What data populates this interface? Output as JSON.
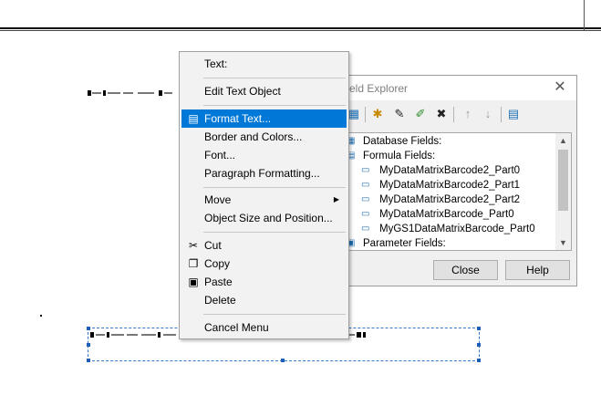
{
  "field_explorer": {
    "title": "eld Explorer",
    "close_glyph": "✕",
    "toolbar": [
      {
        "icon": "insert-to-report-icon",
        "glyph": "▦"
      },
      {
        "icon": "new-icon",
        "glyph": "✱"
      },
      {
        "icon": "edit-icon",
        "glyph": "✎"
      },
      {
        "icon": "rename-icon",
        "glyph": "✐"
      },
      {
        "icon": "delete-icon",
        "glyph": "✖"
      },
      {
        "icon": "move-up-icon",
        "glyph": "↑"
      },
      {
        "icon": "move-down-icon",
        "glyph": "↓"
      },
      {
        "icon": "browse-icon",
        "glyph": "▤"
      }
    ],
    "tree": [
      {
        "label": "Database Fields:",
        "level": 0,
        "icon": "database-fields-icon"
      },
      {
        "label": "Formula Fields:",
        "level": 0,
        "icon": "formula-fields-icon"
      },
      {
        "label": "MyDataMatrixBarcode2_Part0",
        "level": 1,
        "icon": "formula-icon"
      },
      {
        "label": "MyDataMatrixBarcode2_Part1",
        "level": 1,
        "icon": "formula-icon"
      },
      {
        "label": "MyDataMatrixBarcode2_Part2",
        "level": 1,
        "icon": "formula-icon"
      },
      {
        "label": "MyDataMatrixBarcode_Part0",
        "level": 1,
        "icon": "formula-icon"
      },
      {
        "label": "MyGS1DataMatrixBarcode_Part0",
        "level": 1,
        "icon": "formula-icon"
      },
      {
        "label": "Parameter Fields:",
        "level": 0,
        "icon": "parameter-fields-icon"
      }
    ],
    "buttons": {
      "close": "Close",
      "help": "Help"
    }
  },
  "context_menu": {
    "items": [
      {
        "label": "Text:",
        "icon": "",
        "highlighted": false
      },
      {
        "label": "Edit Text Object",
        "icon": "",
        "highlighted": false
      },
      {
        "label": "Format Text...",
        "icon": "format-text-icon",
        "highlighted": true
      },
      {
        "label": "Border and Colors...",
        "icon": "",
        "highlighted": false
      },
      {
        "label": "Font...",
        "icon": "",
        "highlighted": false
      },
      {
        "label": "Paragraph Formatting...",
        "icon": "",
        "highlighted": false
      },
      {
        "label": "Move",
        "icon": "",
        "highlighted": false,
        "submenu": true
      },
      {
        "label": "Object Size and Position...",
        "icon": "",
        "highlighted": false
      },
      {
        "label": "Cut",
        "icon": "cut-icon",
        "highlighted": false
      },
      {
        "label": "Copy",
        "icon": "copy-icon",
        "highlighted": false
      },
      {
        "label": "Paste",
        "icon": "paste-icon",
        "highlighted": false
      },
      {
        "label": "Delete",
        "icon": "",
        "highlighted": false
      },
      {
        "label": "Cancel Menu",
        "icon": "",
        "highlighted": false
      }
    ]
  },
  "colors": {
    "highlight": "#0078d7",
    "selection_border": "#3a78c6",
    "tree_icon": "#1f6fb3"
  }
}
